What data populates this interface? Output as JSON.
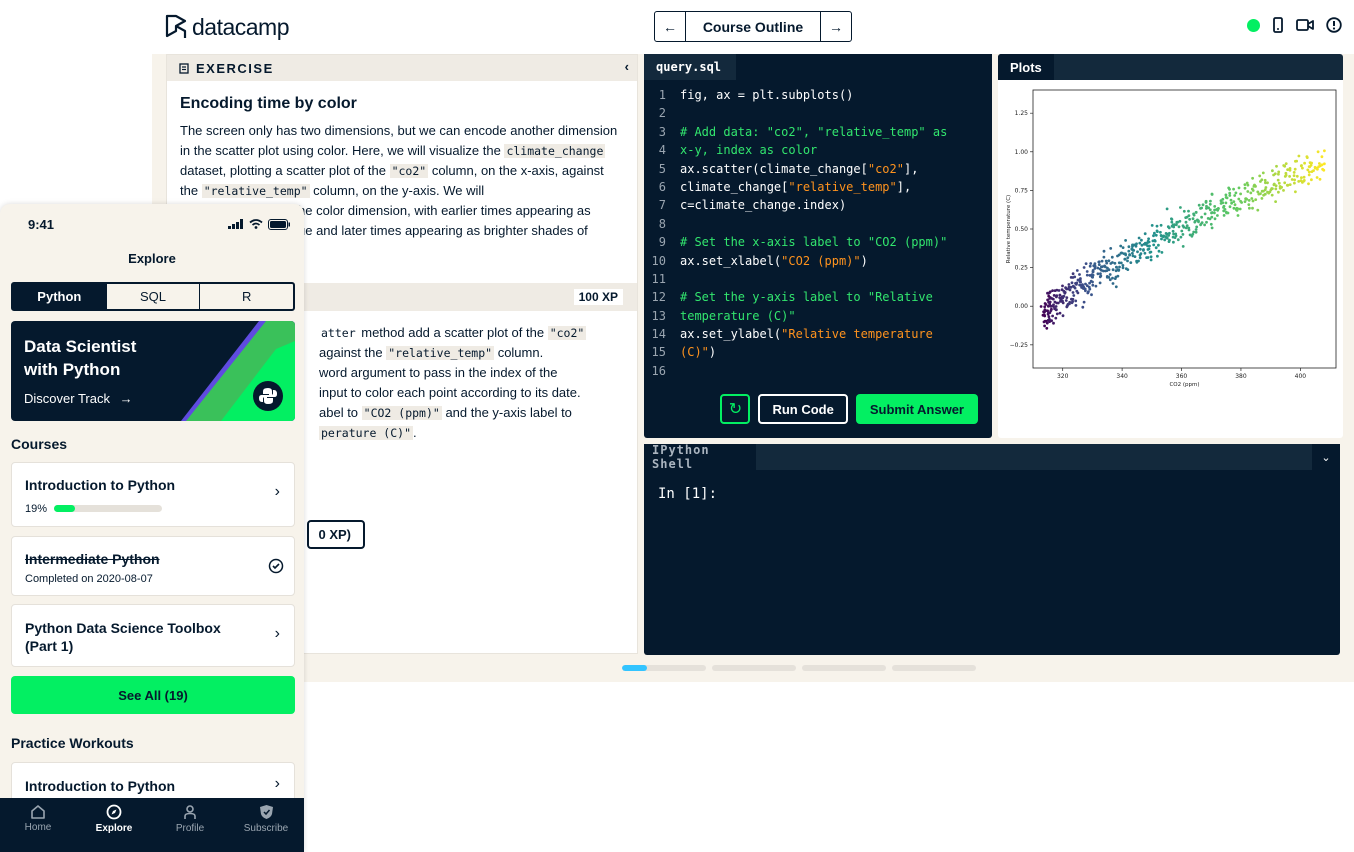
{
  "desktop": {
    "logo_text": "datacamp",
    "nav": {
      "prev": "←",
      "title": "Course Outline",
      "next": "→"
    },
    "exercise": {
      "header": "EXERCISE",
      "collapse": "‹",
      "title": "Encoding time by color",
      "p1_a": "The screen only has two dimensions, but we can encode another dimension in the scatter plot using color. Here, we will visualize the ",
      "p1_code1": "climate_change",
      "p1_b": " dataset, plotting a scatter plot of the ",
      "p1_code2": "\"co2\"",
      "p1_c": " column, on the x-axis, against the ",
      "p1_code3": "\"relative_temp\"",
      "p1_d": " column, on the y-axis. We will",
      "p1_line5": "he color dimension, with earlier times appearing as",
      "p1_line6": "ue and later times appearing as brighter shades of",
      "xp": "100 XP",
      "instr_l1_code": "atter",
      "instr_l1": " method add a scatter plot of the ",
      "instr_l1_code2": "\"co2\"",
      "instr_l2_a": " against the ",
      "instr_l2_code": "\"relative_temp\"",
      "instr_l2_b": " column.",
      "instr_l3": "word argument to pass in the index of the",
      "instr_l4": "input to color each point according to its date.",
      "instr_l5_a": "abel to ",
      "instr_l5_code": "\"CO2 (ppm)\"",
      "instr_l5_b": " and the y-axis label to",
      "instr_l6_code": "perature (C)\"",
      "instr_l6_b": ".",
      "hint_btn": "0 XP)"
    },
    "editor": {
      "tab": "query.sql",
      "lines": [
        {
          "n": "1",
          "parts": [
            {
              "t": "fig, ax = plt.subplots()",
              "c": "def"
            }
          ]
        },
        {
          "n": "2",
          "parts": []
        },
        {
          "n": "3",
          "parts": [
            {
              "t": "# Add data: \"co2\", \"relative_temp\" as",
              "c": "com"
            }
          ]
        },
        {
          "n": "4",
          "parts": [
            {
              "t": "x-y, index as color",
              "c": "com"
            }
          ]
        },
        {
          "n": "5",
          "parts": [
            {
              "t": "ax.scatter(climate_change[",
              "c": "def"
            },
            {
              "t": "\"co2\"",
              "c": "str"
            },
            {
              "t": "],",
              "c": "def"
            }
          ]
        },
        {
          "n": "6",
          "parts": [
            {
              "t": "climate_change[",
              "c": "def"
            },
            {
              "t": "\"relative_temp\"",
              "c": "str"
            },
            {
              "t": "],",
              "c": "def"
            }
          ]
        },
        {
          "n": "7",
          "parts": [
            {
              "t": "c=climate_change.index)",
              "c": "def"
            }
          ]
        },
        {
          "n": "8",
          "parts": []
        },
        {
          "n": "9",
          "parts": [
            {
              "t": "# Set the x-axis label to \"CO2 (ppm)\"",
              "c": "com"
            }
          ]
        },
        {
          "n": "10",
          "parts": [
            {
              "t": "ax.set_xlabel(",
              "c": "def"
            },
            {
              "t": "\"CO2 (ppm)\"",
              "c": "str"
            },
            {
              "t": ")",
              "c": "def"
            }
          ]
        },
        {
          "n": "11",
          "parts": []
        },
        {
          "n": "12",
          "parts": [
            {
              "t": "# Set the y-axis label to \"Relative",
              "c": "com"
            }
          ]
        },
        {
          "n": "13",
          "parts": [
            {
              "t": "temperature (C)\"",
              "c": "com"
            }
          ]
        },
        {
          "n": "14",
          "parts": [
            {
              "t": "ax.set_ylabel(",
              "c": "def"
            },
            {
              "t": "\"Relative temperature",
              "c": "str"
            }
          ]
        },
        {
          "n": "15",
          "parts": [
            {
              "t": "(C)\"",
              "c": "str"
            },
            {
              "t": ")",
              "c": "def"
            }
          ]
        },
        {
          "n": "16",
          "parts": []
        }
      ],
      "reset_icon": "↻",
      "run": "Run Code",
      "submit": "Submit Answer"
    },
    "plots": {
      "tab": "Plots"
    },
    "shell": {
      "tab": "IPython Shell",
      "collapse": "⌄",
      "prompt": "In [1]:"
    },
    "progress": [
      0.3,
      0,
      0,
      0
    ]
  },
  "chart_data": {
    "type": "scatter",
    "xlabel": "CO2 (ppm)",
    "ylabel": "Relative temperature (C)",
    "xlim": [
      310,
      412
    ],
    "ylim": [
      -0.4,
      1.4
    ],
    "xticks": [
      320,
      340,
      360,
      380,
      400
    ],
    "yticks": [
      -0.25,
      0.0,
      0.25,
      0.5,
      0.75,
      1.0,
      1.25
    ],
    "ytick_labels": [
      "−0.25",
      "0.00",
      "0.25",
      "0.50",
      "0.75",
      "1.00",
      "1.25"
    ],
    "colormap": [
      "#440154",
      "#3b528b",
      "#21918c",
      "#5ec962",
      "#fde725"
    ],
    "n_points": 600,
    "trend": {
      "x_start": 314,
      "x_end": 408,
      "y_start": -0.05,
      "y_end": 0.95
    }
  },
  "phone": {
    "time": "9:41",
    "title": "Explore",
    "segments": [
      "Python",
      "SQL",
      "R"
    ],
    "track": {
      "title": "Data Scientist with Python",
      "link": "Discover Track",
      "arrow": "→"
    },
    "courses_heading": "Courses",
    "courses": [
      {
        "title": "Introduction to Python",
        "progress_label": "19%",
        "progress": 0.19
      },
      {
        "title": "Intermediate Python",
        "completed": "Completed on 2020-08-07"
      },
      {
        "title": "Python Data Science Toolbox (Part 1)"
      }
    ],
    "see_all": "See All (19)",
    "practice_heading": "Practice Workouts",
    "practice": [
      {
        "title": "Introduction to Python"
      }
    ],
    "tabs": [
      "Home",
      "Explore",
      "Profile",
      "Subscribe"
    ]
  }
}
